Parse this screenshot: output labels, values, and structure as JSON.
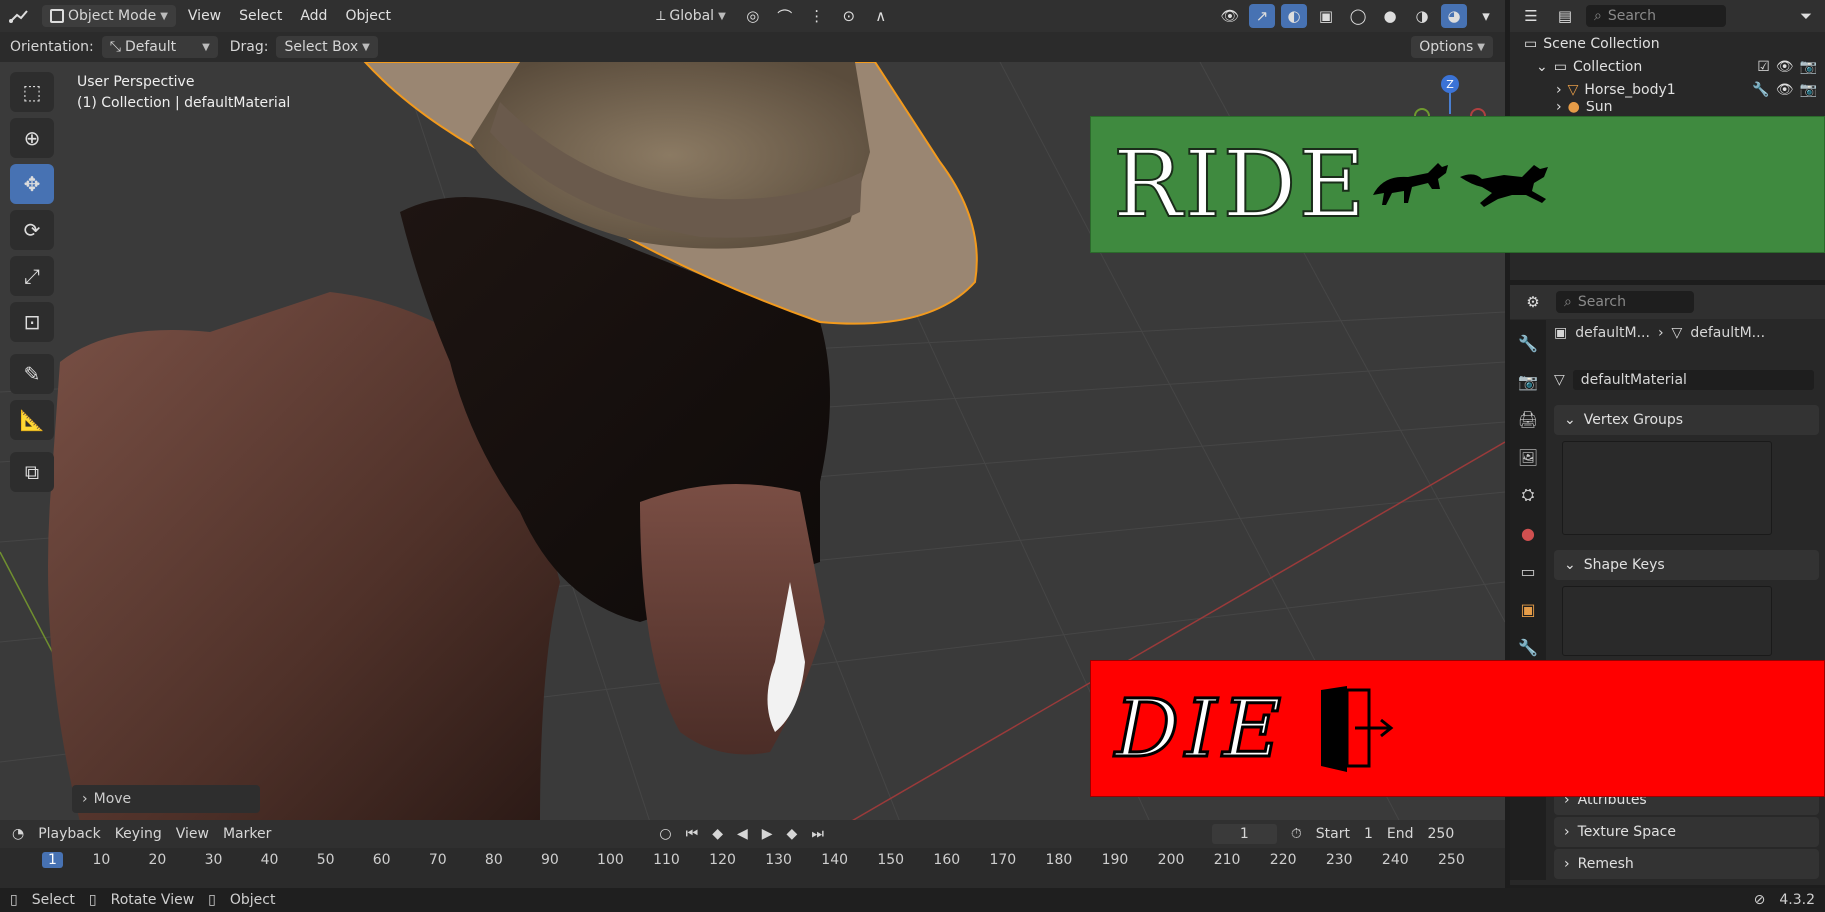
{
  "header": {
    "mode": "Object Mode",
    "menus": [
      "View",
      "Select",
      "Add",
      "Object"
    ],
    "transform_orientation": "Global"
  },
  "options_bar": {
    "orientation_label": "Orientation:",
    "orientation_value": "Default",
    "drag_label": "Drag:",
    "drag_value": "Select Box",
    "options_label": "Options"
  },
  "viewport": {
    "perspective": "User Perspective",
    "context": "(1) Collection | defaultMaterial",
    "last_op": "Move",
    "gizmo_axis": "Z"
  },
  "outliner": {
    "search_placeholder": "Search",
    "scene_collection": "Scene Collection",
    "collection": "Collection",
    "items": [
      "Horse_body1",
      "Sun"
    ]
  },
  "properties": {
    "search_placeholder": "Search",
    "breadcrumb_object": "defaultM...",
    "breadcrumb_data": "defaultM...",
    "mesh_name": "defaultMaterial",
    "panels": [
      "Vertex Groups",
      "Shape Keys",
      "Attributes",
      "Texture Space",
      "Remesh"
    ]
  },
  "timeline": {
    "menus": [
      "Playback",
      "Keying",
      "View",
      "Marker"
    ],
    "current_frame": "1",
    "start_label": "Start",
    "start_value": "1",
    "end_label": "End",
    "end_value": "250",
    "ticks": [
      "1",
      "10",
      "20",
      "30",
      "40",
      "50",
      "60",
      "70",
      "80",
      "90",
      "100",
      "110",
      "120",
      "130",
      "140",
      "150",
      "160",
      "170",
      "180",
      "190",
      "200",
      "210",
      "220",
      "230",
      "240",
      "250"
    ]
  },
  "status_bar": {
    "select": "Select",
    "rotate_view": "Rotate View",
    "object": "Object",
    "version": "4.3.2"
  },
  "overlay_top": {
    "text": "RIDE",
    "bg_color": "#3f8a3f"
  },
  "overlay_bottom": {
    "text": "DIE",
    "bg_color": "#ff0000"
  }
}
